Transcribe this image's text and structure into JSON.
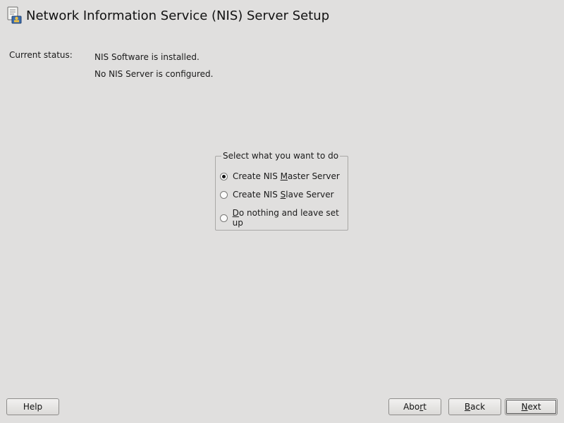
{
  "header": {
    "title": "Network Information Service (NIS) Server Setup",
    "icon": "nis-server-icon"
  },
  "status": {
    "label": "Current status:",
    "lines": [
      "NIS Software is installed.",
      "No NIS Server is configured."
    ]
  },
  "selection": {
    "legend": "Select what you want to do",
    "options": [
      {
        "pre": "Create NIS ",
        "mnemonic": "M",
        "post": "aster Server",
        "checked": true
      },
      {
        "pre": "Create NIS ",
        "mnemonic": "S",
        "post": "lave Server",
        "checked": false
      },
      {
        "pre": "",
        "mnemonic": "D",
        "post": "o nothing and leave set up",
        "checked": false
      }
    ]
  },
  "buttons": {
    "help": {
      "pre": "Help",
      "mnemonic": "",
      "post": ""
    },
    "abort": {
      "pre": "Abo",
      "mnemonic": "r",
      "post": "t"
    },
    "back": {
      "pre": "",
      "mnemonic": "B",
      "post": "ack"
    },
    "next": {
      "pre": "",
      "mnemonic": "N",
      "post": "ext"
    }
  },
  "colors": {
    "background": "#e0dfde",
    "border": "#a9a8a6"
  }
}
